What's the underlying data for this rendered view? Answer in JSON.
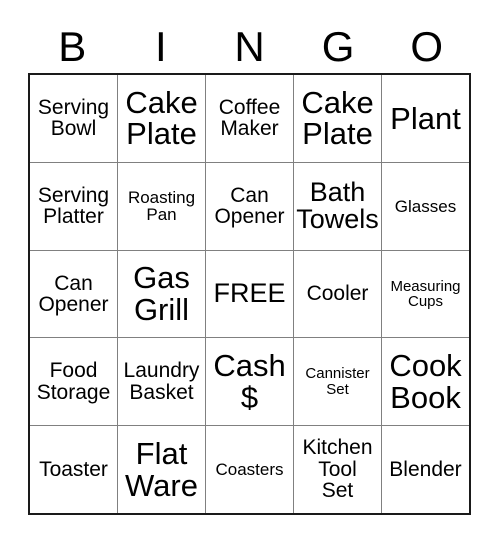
{
  "card": {
    "header_letters": [
      "B",
      "I",
      "N",
      "G",
      "O"
    ],
    "rows": [
      [
        {
          "text": "Serving\nBowl",
          "size": "fs-md"
        },
        {
          "text": "Cake\nPlate",
          "size": "fs-xl"
        },
        {
          "text": "Coffee\nMaker",
          "size": "fs-md"
        },
        {
          "text": "Cake\nPlate",
          "size": "fs-xl"
        },
        {
          "text": "Plant",
          "size": "fs-xl"
        }
      ],
      [
        {
          "text": "Serving\nPlatter",
          "size": "fs-md"
        },
        {
          "text": "Roasting\nPan",
          "size": "fs-sm"
        },
        {
          "text": "Can\nOpener",
          "size": "fs-md"
        },
        {
          "text": "Bath\nTowels",
          "size": "fs-lg"
        },
        {
          "text": "Glasses",
          "size": "fs-sm"
        }
      ],
      [
        {
          "text": "Can\nOpener",
          "size": "fs-md"
        },
        {
          "text": "Gas\nGrill",
          "size": "fs-xl"
        },
        {
          "text": "FREE",
          "size": "fs-lg"
        },
        {
          "text": "Cooler",
          "size": "fs-md"
        },
        {
          "text": "Measuring\nCups",
          "size": "fs-xs"
        }
      ],
      [
        {
          "text": "Food\nStorage",
          "size": "fs-md"
        },
        {
          "text": "Laundry\nBasket",
          "size": "fs-md"
        },
        {
          "text": "Cash\n$",
          "size": "fs-xl"
        },
        {
          "text": "Cannister\nSet",
          "size": "fs-xs"
        },
        {
          "text": "Cook\nBook",
          "size": "fs-xl"
        }
      ],
      [
        {
          "text": "Toaster",
          "size": "fs-md"
        },
        {
          "text": "Flat\nWare",
          "size": "fs-xl"
        },
        {
          "text": "Coasters",
          "size": "fs-sm"
        },
        {
          "text": "Kitchen\nTool\nSet",
          "size": "fs-md"
        },
        {
          "text": "Blender",
          "size": "fs-md"
        }
      ]
    ]
  }
}
